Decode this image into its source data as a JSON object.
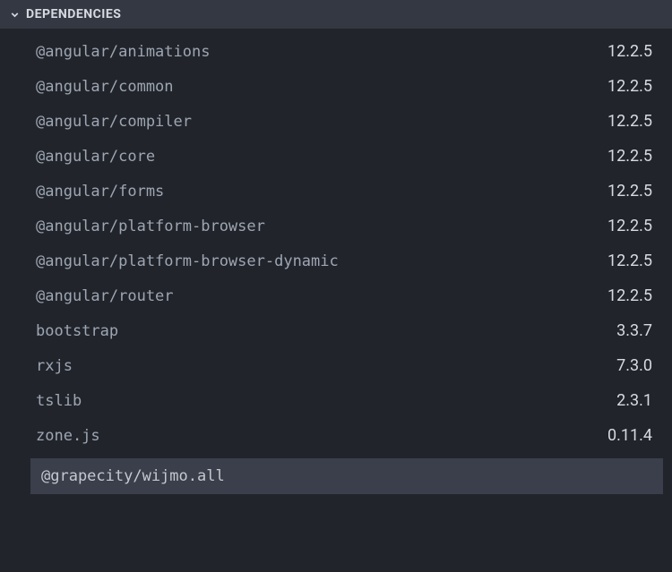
{
  "header": {
    "title": "DEPENDENCIES"
  },
  "dependencies": [
    {
      "name": "@angular/animations",
      "version": "12.2.5"
    },
    {
      "name": "@angular/common",
      "version": "12.2.5"
    },
    {
      "name": "@angular/compiler",
      "version": "12.2.5"
    },
    {
      "name": "@angular/core",
      "version": "12.2.5"
    },
    {
      "name": "@angular/forms",
      "version": "12.2.5"
    },
    {
      "name": "@angular/platform-browser",
      "version": "12.2.5"
    },
    {
      "name": "@angular/platform-browser-dynamic",
      "version": "12.2.5"
    },
    {
      "name": "@angular/router",
      "version": "12.2.5"
    },
    {
      "name": "bootstrap",
      "version": "3.3.7"
    },
    {
      "name": "rxjs",
      "version": "7.3.0"
    },
    {
      "name": "tslib",
      "version": "2.3.1"
    },
    {
      "name": "zone.js",
      "version": "0.11.4"
    }
  ],
  "input": {
    "value": "@grapecity/wijmo.all"
  }
}
